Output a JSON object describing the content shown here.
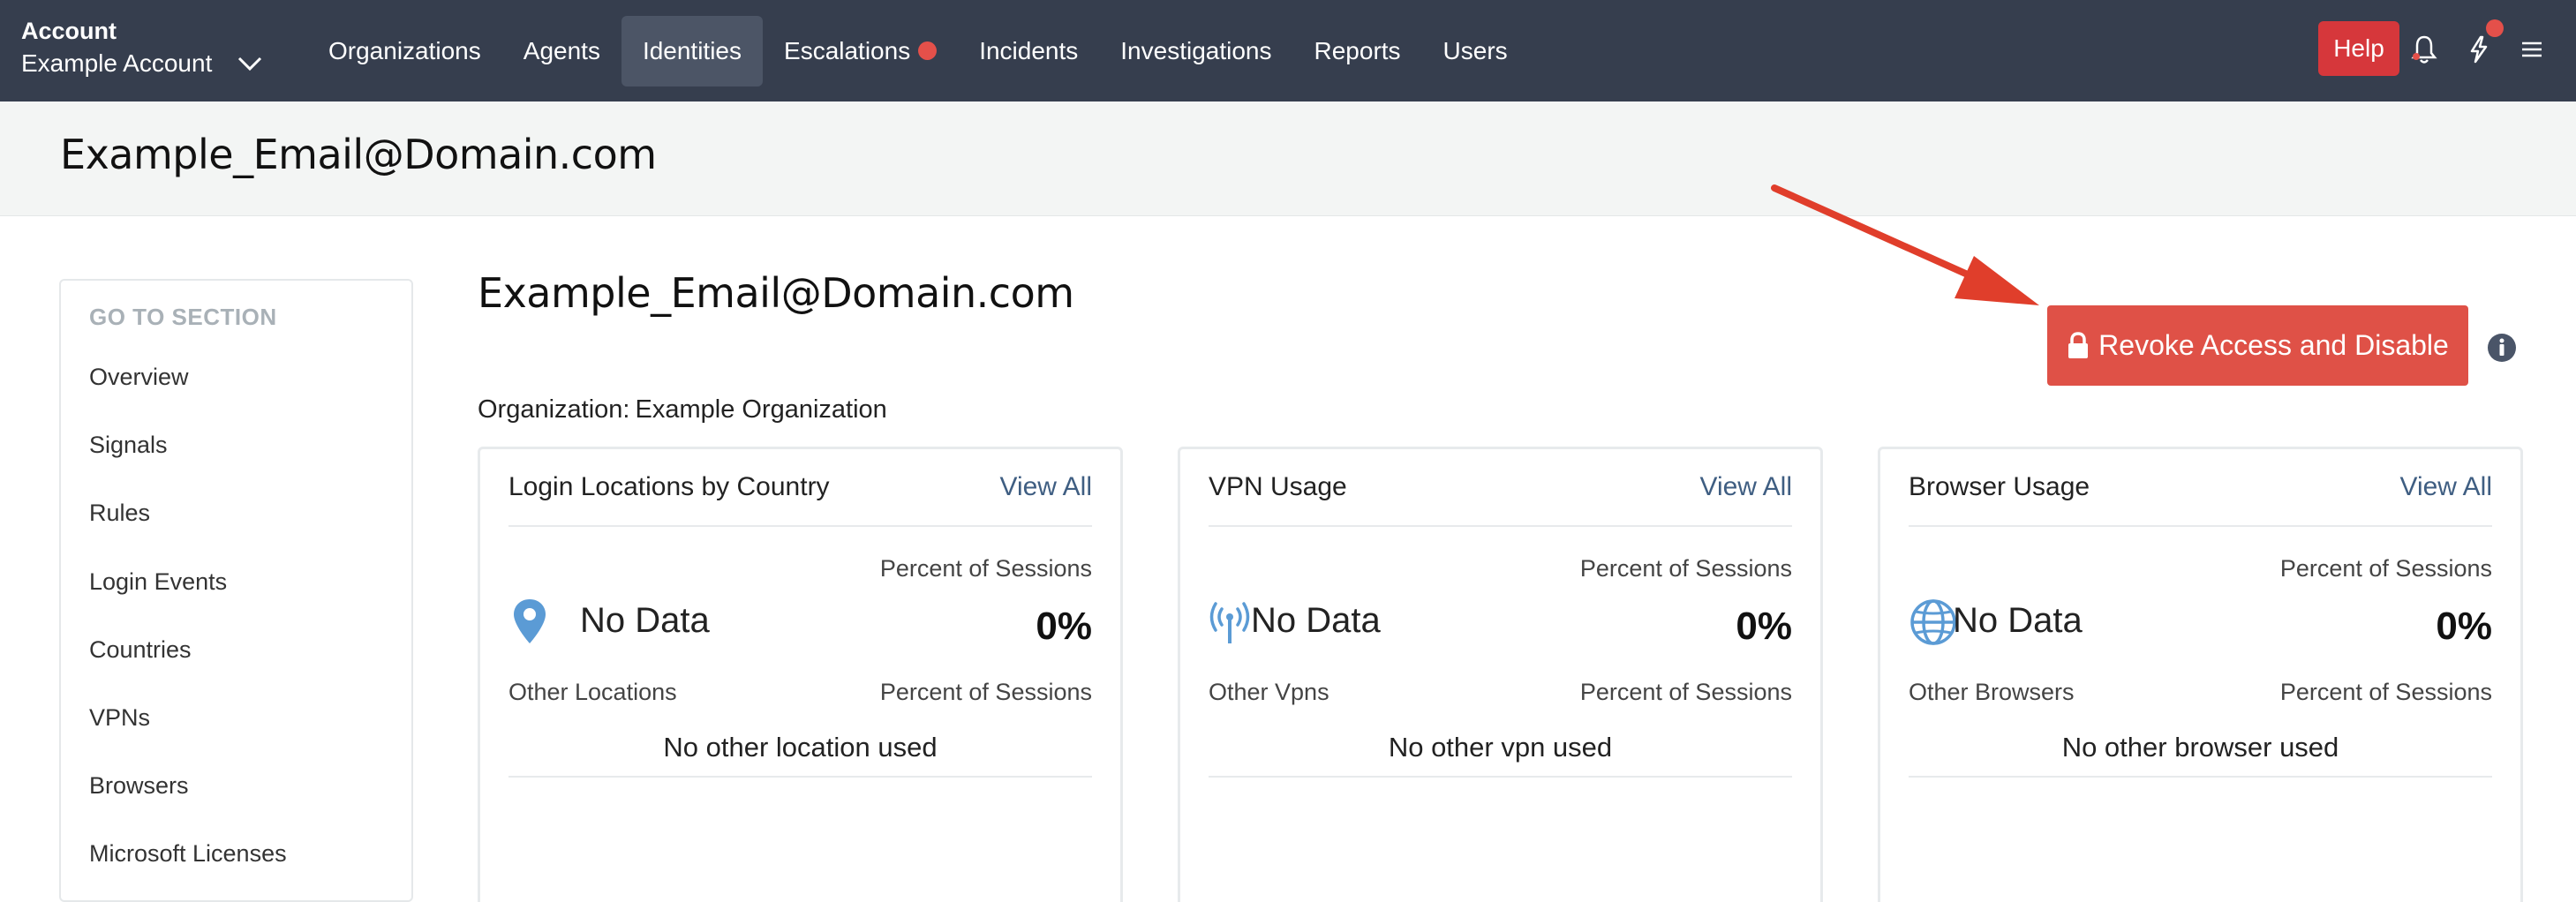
{
  "nav": {
    "account_label": "Account",
    "account_value": "Example Account",
    "items": [
      {
        "label": "Organizations"
      },
      {
        "label": "Agents"
      },
      {
        "label": "Identities"
      },
      {
        "label": "Escalations"
      },
      {
        "label": "Incidents"
      },
      {
        "label": "Investigations"
      },
      {
        "label": "Reports"
      },
      {
        "label": "Users"
      }
    ],
    "active_item": "Identities",
    "help_label": "Help",
    "icons": [
      "chevron-down-icon",
      "bell-icon",
      "bolt-icon",
      "hamburger-menu-icon"
    ]
  },
  "header": {
    "title": "Example_Email@Domain.com"
  },
  "sidebar": {
    "title": "GO TO SECTION",
    "items": [
      {
        "label": "Overview"
      },
      {
        "label": "Signals"
      },
      {
        "label": "Rules"
      },
      {
        "label": "Login Events"
      },
      {
        "label": "Countries"
      },
      {
        "label": "VPNs"
      },
      {
        "label": "Browsers"
      },
      {
        "label": "Microsoft Licenses"
      }
    ]
  },
  "main": {
    "title": "Example_Email@Domain.com",
    "org_label": "Organization:",
    "org_value": "Example Organization",
    "revoke_label": "Revoke Access and Disable",
    "cards": [
      {
        "title": "Login Locations by Country",
        "link": "View All",
        "pct_label": "Percent of Sessions",
        "no_data": "No Data",
        "pct_value": "0%",
        "other_label": "Other Locations",
        "other_pct_label": "Percent of Sessions",
        "none_used": "No other location used",
        "icon": "map-pin-icon"
      },
      {
        "title": "VPN Usage",
        "link": "View All",
        "pct_label": "Percent of Sessions",
        "no_data": "No Data",
        "pct_value": "0%",
        "other_label": "Other Vpns",
        "other_pct_label": "Percent of Sessions",
        "none_used": "No other vpn used",
        "icon": "antenna-icon"
      },
      {
        "title": "Browser Usage",
        "link": "View All",
        "pct_label": "Percent of Sessions",
        "no_data": "No Data",
        "pct_value": "0%",
        "other_label": "Other Browsers",
        "other_pct_label": "Percent of Sessions",
        "none_used": "No other browser used",
        "icon": "globe-icon"
      }
    ]
  },
  "colors": {
    "nav_bg": "#363e4e",
    "accent_red": "#df5147",
    "link_blue": "#3f5e82",
    "icon_blue": "#5b9bd5"
  }
}
